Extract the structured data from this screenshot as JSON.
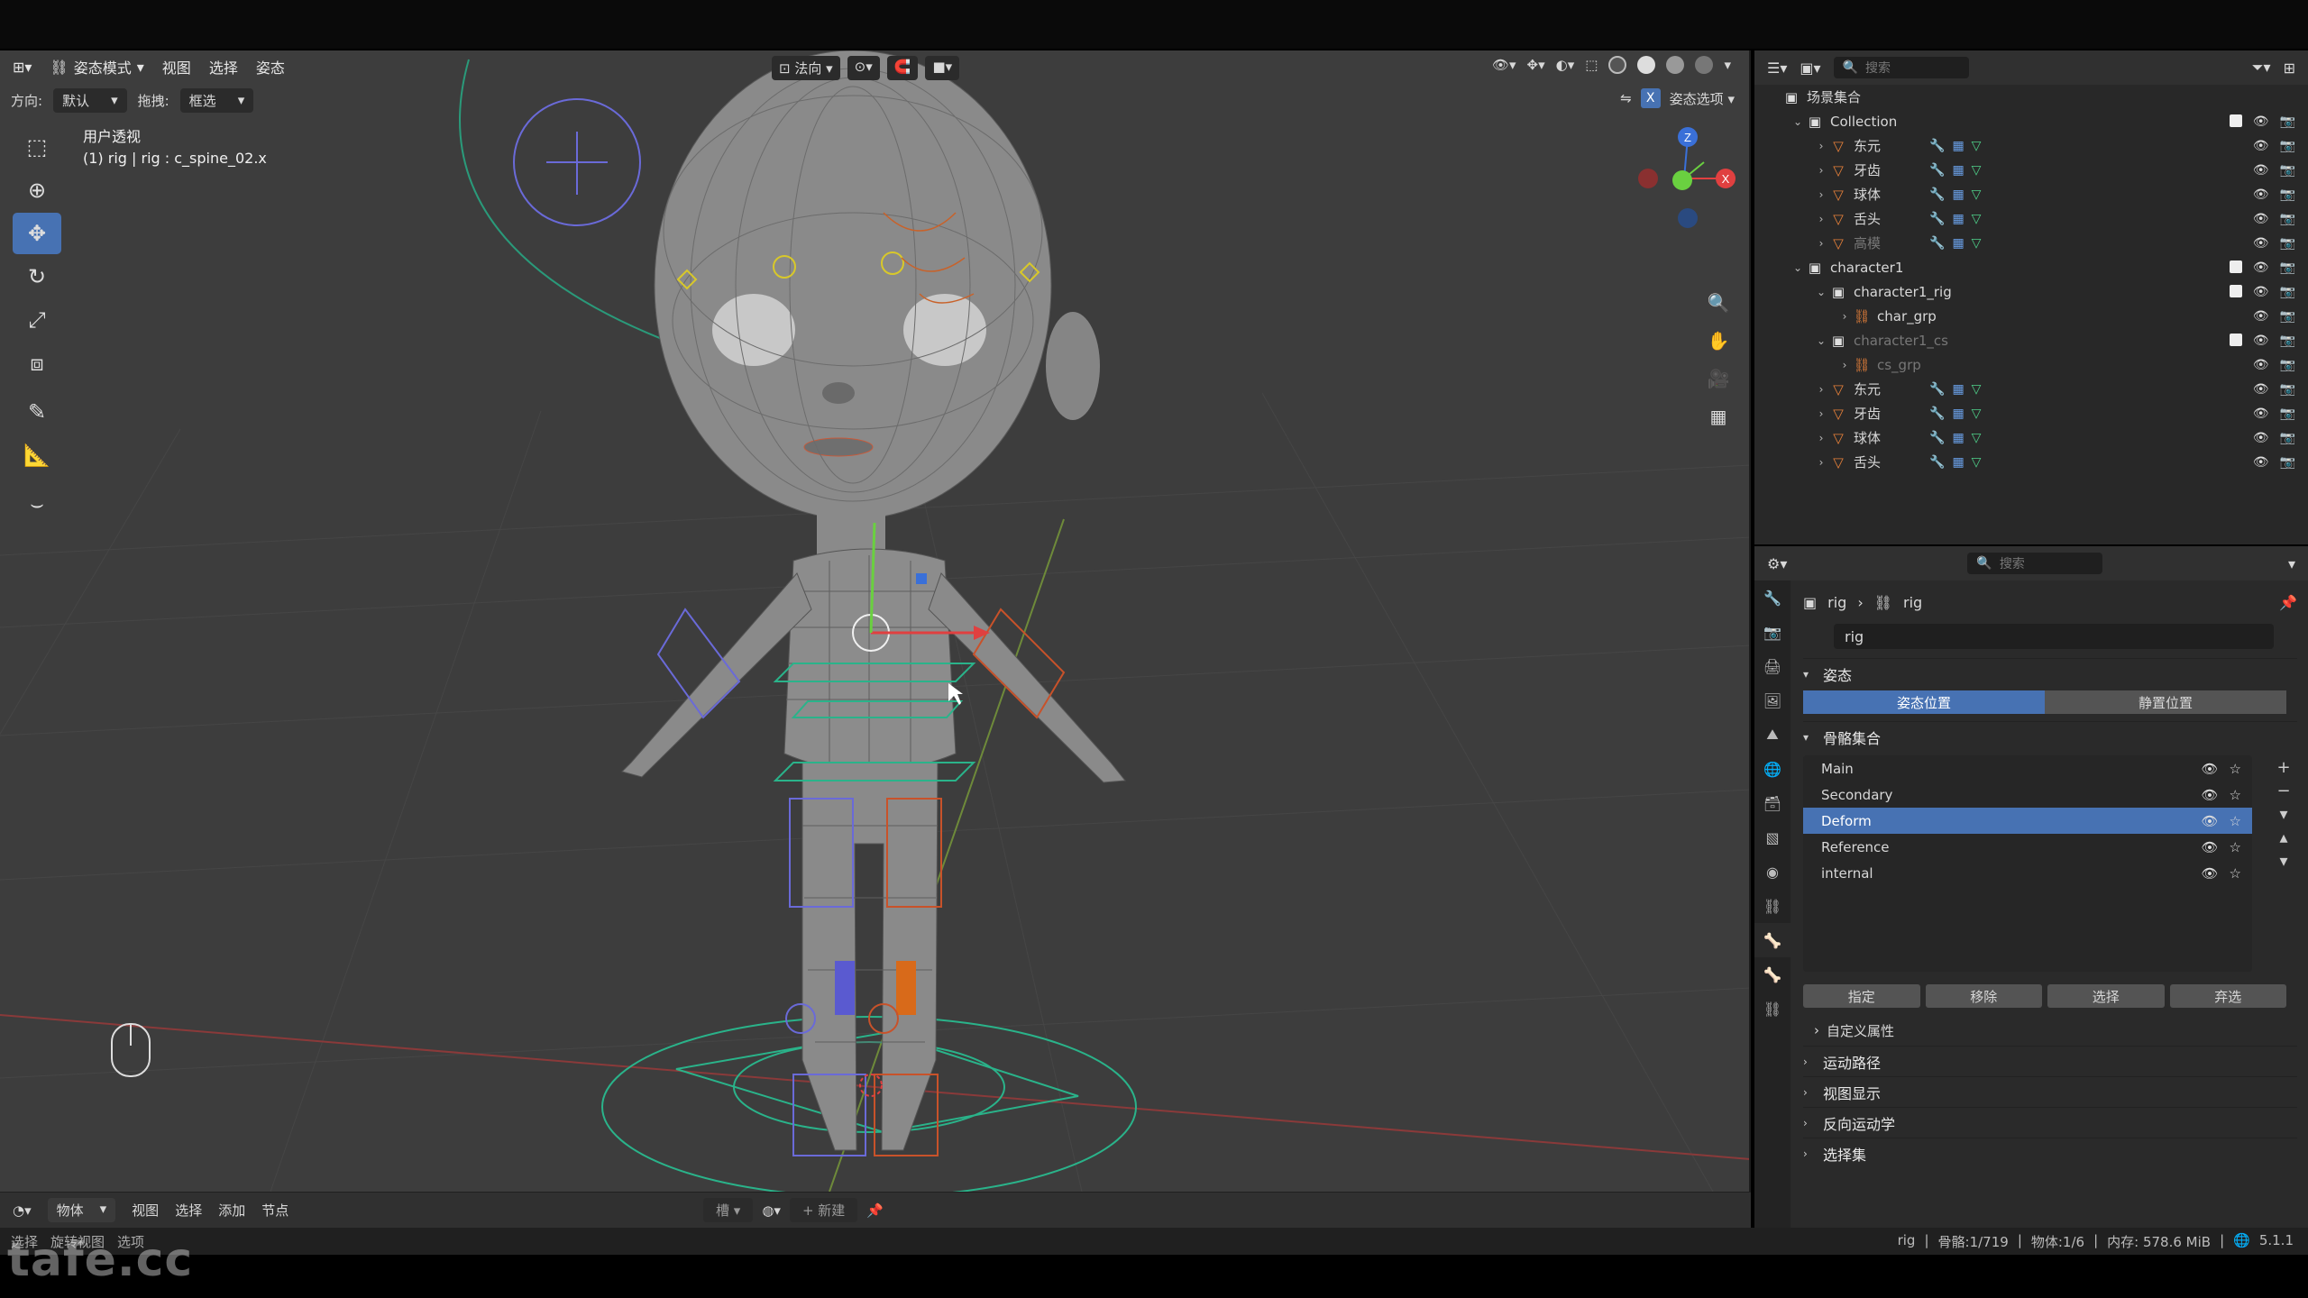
{
  "viewport": {
    "mode": "姿态模式",
    "menus": [
      "视图",
      "选择",
      "姿态"
    ],
    "orientation_label": "方向:",
    "orientation_value": "默认",
    "drag_label": "拖拽:",
    "drag_value": "框选",
    "transform_orientation": "法向",
    "pose_options": "姿态选项",
    "x_toggle": "X",
    "view_name": "用户透视",
    "active_info": "(1) rig | rig : c_spine_02.x",
    "gizmo_axes": {
      "z": "Z",
      "x": "X"
    }
  },
  "timeline": {
    "editor": "物体",
    "menus": [
      "视图",
      "选择",
      "添加",
      "节点"
    ],
    "slot_label": "槽",
    "new_label": "新建"
  },
  "statusbar": {
    "left": [
      "选择",
      "旋转视图",
      "选项"
    ],
    "right": [
      "rig",
      "骨骼:1/719",
      "物体:1/6",
      "内存: 578.6 MiB",
      "5.1.1"
    ]
  },
  "watermark": "tafe.cc",
  "outliner": {
    "search_placeholder": "搜索",
    "rows": [
      {
        "label": "场景集合",
        "type": "scene",
        "indent": 0
      },
      {
        "label": "Collection",
        "type": "collection",
        "indent": 1
      },
      {
        "label": "东元",
        "type": "mesh",
        "indent": 2
      },
      {
        "label": "牙齿",
        "type": "mesh",
        "indent": 2
      },
      {
        "label": "球体",
        "type": "mesh",
        "indent": 2
      },
      {
        "label": "舌头",
        "type": "mesh",
        "indent": 2
      },
      {
        "label": "高模",
        "type": "mesh",
        "indent": 2,
        "dim": true
      },
      {
        "label": "character1",
        "type": "collection",
        "indent": 1
      },
      {
        "label": "character1_rig",
        "type": "collection",
        "indent": 2
      },
      {
        "label": "char_grp",
        "type": "armature",
        "indent": 3
      },
      {
        "label": "character1_cs",
        "type": "collection",
        "indent": 2,
        "dim": true
      },
      {
        "label": "cs_grp",
        "type": "armature",
        "indent": 3,
        "dim": true
      },
      {
        "label": "东元",
        "type": "mesh",
        "indent": 2
      },
      {
        "label": "牙齿",
        "type": "mesh",
        "indent": 2
      },
      {
        "label": "球体",
        "type": "mesh",
        "indent": 2
      },
      {
        "label": "舌头",
        "type": "mesh",
        "indent": 2
      }
    ]
  },
  "properties": {
    "search_placeholder": "搜索",
    "breadcrumb": [
      "rig",
      "rig"
    ],
    "name_value": "rig",
    "pose_panel": "姿态",
    "pose_position": "姿态位置",
    "rest_position": "静置位置",
    "bone_collections_panel": "骨骼集合",
    "bone_collections": [
      {
        "name": "Main",
        "selected": false
      },
      {
        "name": "Secondary",
        "selected": false
      },
      {
        "name": "Deform",
        "selected": true
      },
      {
        "name": "Reference",
        "selected": false
      },
      {
        "name": "internal",
        "selected": false
      }
    ],
    "buttons": [
      "指定",
      "移除",
      "选择",
      "弃选"
    ],
    "custom_props": "自定义属性",
    "panels": [
      "运动路径",
      "视图显示",
      "反向运动学",
      "选择集"
    ]
  },
  "colors": {
    "accent": "#4772b3",
    "viewport_bg": "#3d3d3d",
    "panel_bg": "#2a2a2a",
    "mesh_icon": "#e8813a",
    "vertex_group": "#4fd18a"
  }
}
